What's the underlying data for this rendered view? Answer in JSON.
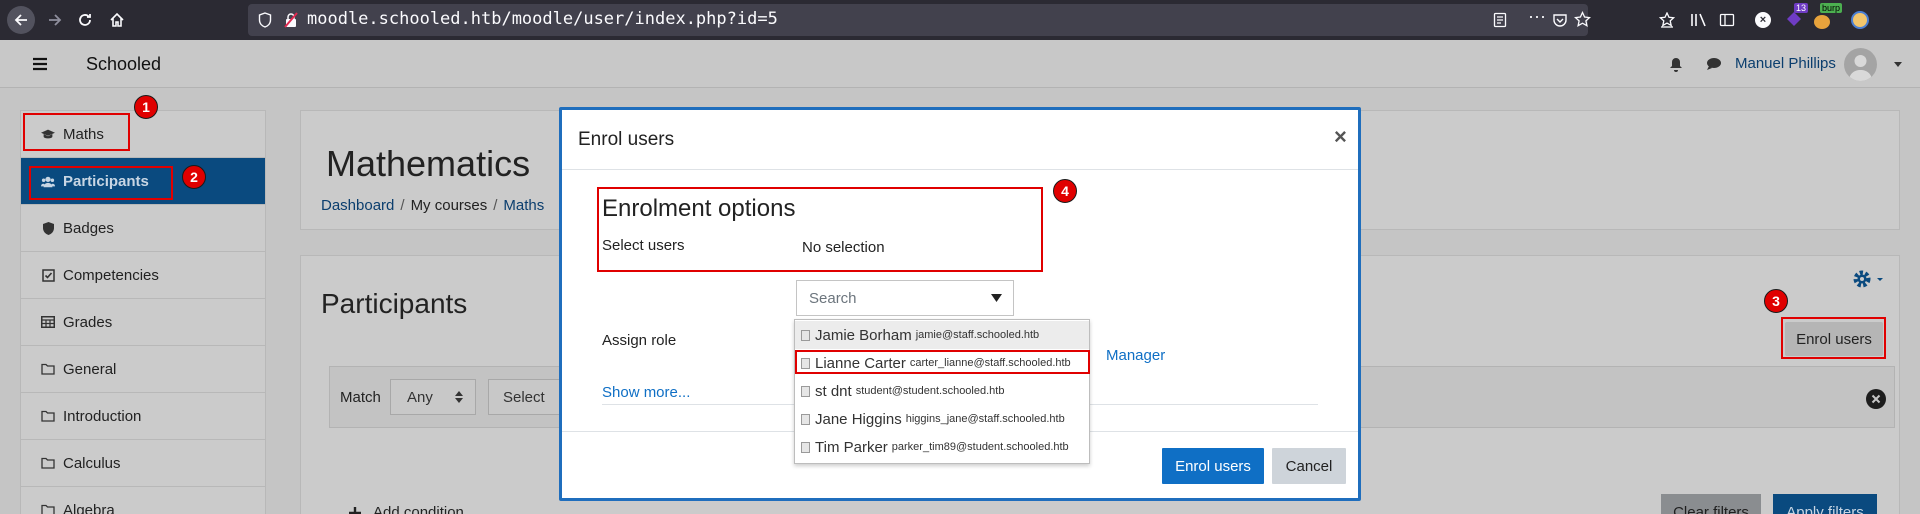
{
  "browser": {
    "url": "moodle.schooled.htb/moodle/user/index.php?id=5",
    "ext_badge_count": "13",
    "ext_label": "burp"
  },
  "topnav": {
    "site_name": "Schooled",
    "user_name": "Manuel Phillips"
  },
  "sidebar": {
    "items": [
      {
        "label": "Maths",
        "icon": "graduation-cap-icon"
      },
      {
        "label": "Participants",
        "icon": "users-icon"
      },
      {
        "label": "Badges",
        "icon": "shield-icon"
      },
      {
        "label": "Competencies",
        "icon": "check-square-icon"
      },
      {
        "label": "Grades",
        "icon": "table-icon"
      },
      {
        "label": "General",
        "icon": "folder-icon"
      },
      {
        "label": "Introduction",
        "icon": "folder-icon"
      },
      {
        "label": "Calculus",
        "icon": "folder-icon"
      },
      {
        "label": "Algebra",
        "icon": "folder-icon"
      }
    ]
  },
  "course": {
    "title": "Mathematics",
    "breadcrumb": [
      "Dashboard",
      "My courses",
      "Maths"
    ]
  },
  "participants": {
    "title": "Participants",
    "enrol_button": "Enrol users",
    "match_label": "Match",
    "match_value": "Any",
    "select_value": "Select",
    "add_condition": "Add condition",
    "clear_filters": "Clear filters",
    "apply_filters": "Apply filters"
  },
  "modal": {
    "title": "Enrol users",
    "close": "×",
    "section_title": "Enrolment options",
    "select_users_label": "Select users",
    "no_selection": "No selection",
    "search_placeholder": "Search",
    "assign_role_label": "Assign role",
    "role_value": "Manager",
    "show_more": "Show more...",
    "enrol_button": "Enrol users",
    "cancel_button": "Cancel"
  },
  "dropdown": {
    "options": [
      {
        "name": "Jamie Borham",
        "email": "jamie@staff.schooled.htb"
      },
      {
        "name": "Lianne Carter",
        "email": "carter_lianne@staff.schooled.htb"
      },
      {
        "name": "st dnt",
        "email": "student@student.schooled.htb"
      },
      {
        "name": "Jane Higgins",
        "email": "higgins_jane@staff.schooled.htb"
      },
      {
        "name": "Tim Parker",
        "email": "parker_tim89@student.schooled.htb"
      }
    ]
  },
  "annotations": [
    "1",
    "2",
    "3",
    "4"
  ],
  "colors": {
    "annotation_red": "#e00000",
    "primary_blue": "#0f6fc5",
    "active_nav": "#0a4a7f"
  }
}
